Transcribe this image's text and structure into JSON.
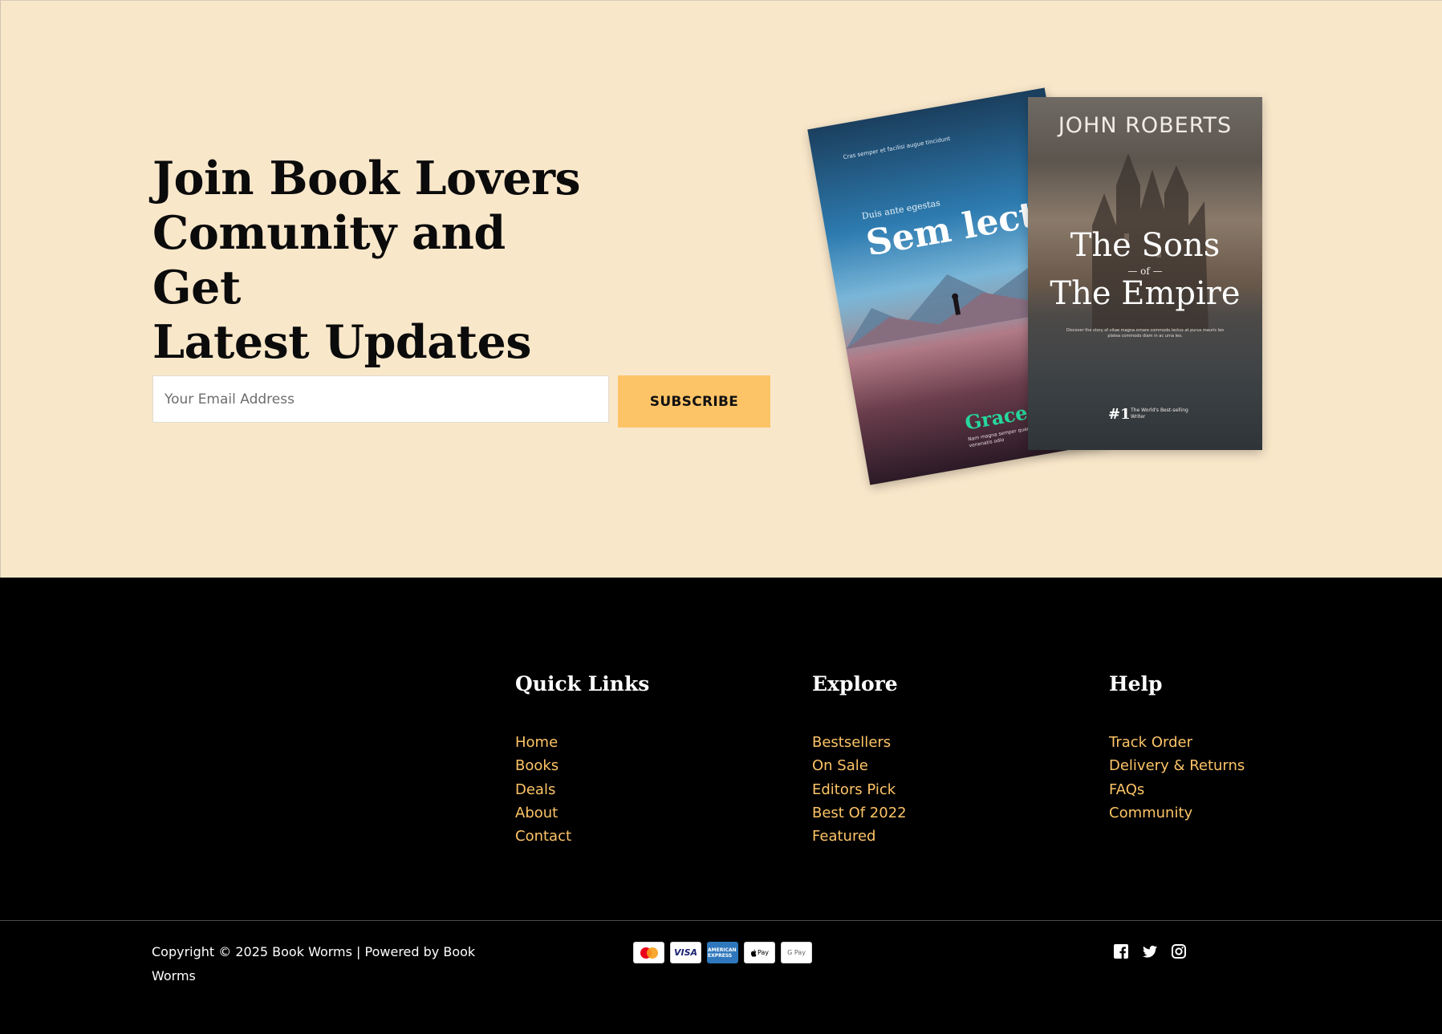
{
  "newsletter": {
    "headline_lines": [
      "Join Book Lovers",
      "Comunity and Get",
      "Latest Updates"
    ],
    "email_placeholder": "Your Email Address",
    "subscribe_label": "SUBSCRIBE",
    "background_color": "#f9e7ca",
    "button_color": "#fdc467"
  },
  "books": {
    "back": {
      "tiny_top": "Cras semper et facilisi augue tincidunt",
      "subtitle": "Duis ante egestas",
      "title": "Sem lectu",
      "author": "Grace Bry",
      "blurb": "Nam magna semper quam eu vel morbi suspendisse venenatis odio"
    },
    "front": {
      "author": "JOHN ROBERTS",
      "title_line1": "The Sons",
      "title_of": "— of —",
      "title_line2": "The Empire",
      "blurb": "Discover the story of vitae magna ornare commodo lectus at purus mauris leo platea commodo diam in ac urna leo.",
      "rank": "#1",
      "rank_text": "The World's Best-selling Writer"
    }
  },
  "footer": {
    "quick_links": {
      "title": "Quick Links",
      "items": [
        "Home",
        "Books",
        "Deals",
        "About",
        "Contact"
      ]
    },
    "explore": {
      "title": "Explore",
      "items": [
        "Bestsellers",
        "On Sale",
        "Editors Pick",
        "Best Of 2022",
        "Featured"
      ]
    },
    "help": {
      "title": "Help",
      "items": [
        "Track Order",
        "Delivery & Returns",
        "FAQs",
        "Community"
      ]
    },
    "copyright": "Copyright © 2025 Book Worms | Powered by Book Worms",
    "payments": {
      "mastercard_icon": "mastercard-icon",
      "visa_label": "VISA",
      "amex_label": "AMERICAN EXPRESS",
      "applepay_label": "Pay",
      "gpay_label": "G Pay"
    },
    "social_icons": [
      "facebook-icon",
      "twitter-icon",
      "instagram-icon"
    ],
    "link_color": "#fdc467"
  }
}
